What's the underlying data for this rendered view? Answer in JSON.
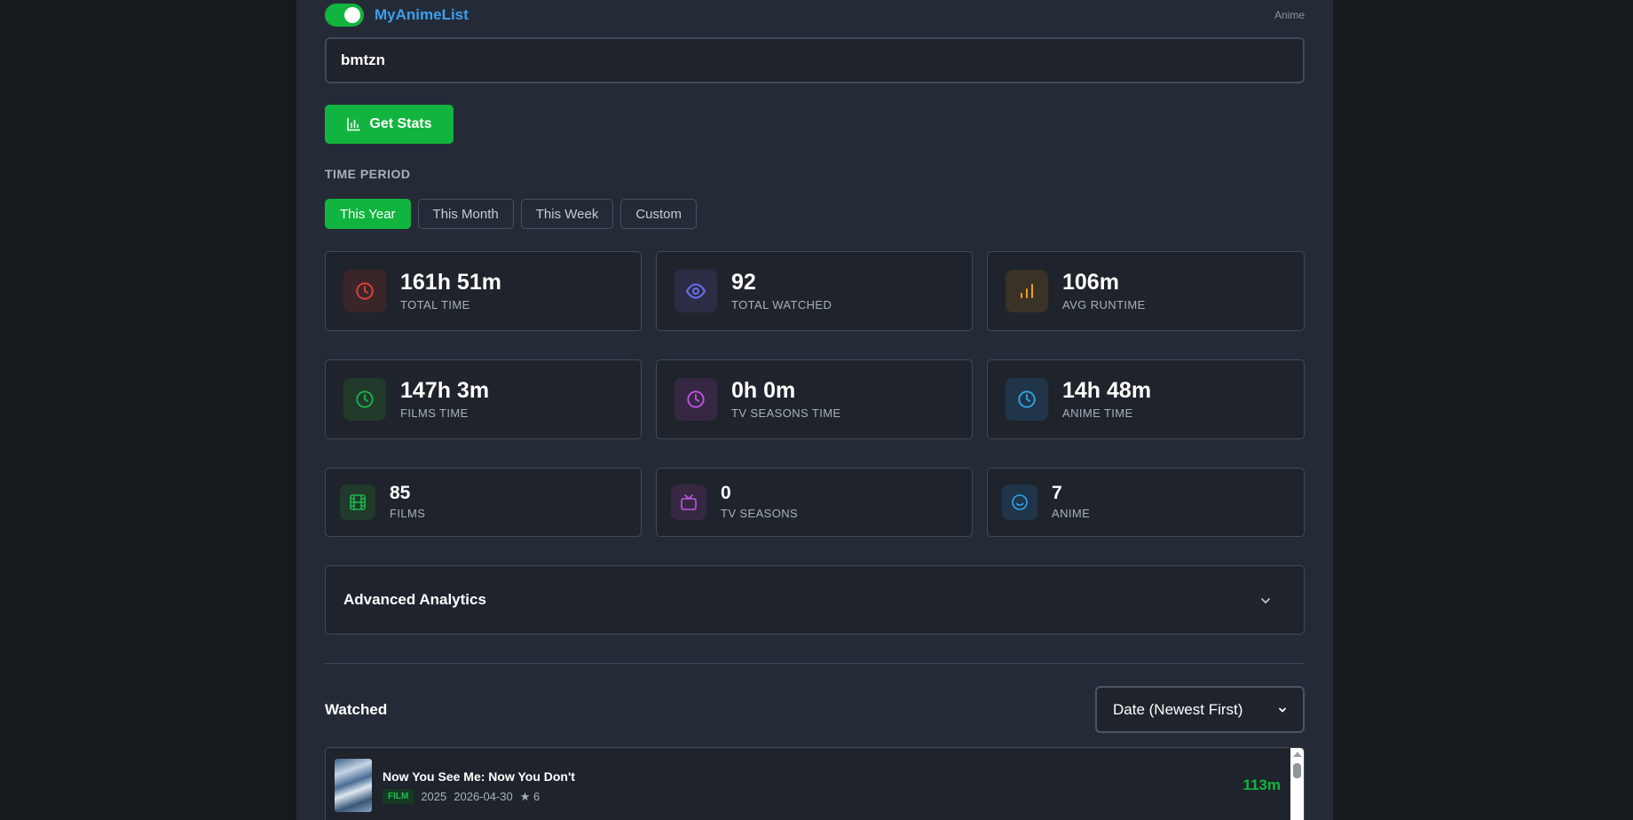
{
  "header": {
    "source_label": "MyAnimeList",
    "media_tag": "Anime",
    "toggle_on": true
  },
  "search": {
    "username_value": "bmtzn"
  },
  "actions": {
    "get_stats_label": "Get Stats"
  },
  "time_period": {
    "label": "TIME PERIOD",
    "options": [
      "This Year",
      "This Month",
      "This Week",
      "Custom"
    ],
    "selected": "This Year"
  },
  "stats": [
    {
      "value": "161h 51m",
      "label": "TOTAL TIME",
      "icon": "clock-icon",
      "color": "#e5413b",
      "bg": "#3a2629"
    },
    {
      "value": "92",
      "label": "TOTAL WATCHED",
      "icon": "eye-icon",
      "color": "#6d6ef2",
      "bg": "#2c2d45"
    },
    {
      "value": "106m",
      "label": "AVG RUNTIME",
      "icon": "bar-chart-icon",
      "color": "#f2a01f",
      "bg": "#3a3226"
    },
    {
      "value": "147h 3m",
      "label": "FILMS TIME",
      "icon": "clock-icon",
      "color": "#18b54a",
      "bg": "#223a2c"
    },
    {
      "value": "0h 0m",
      "label": "TV SEASONS TIME",
      "icon": "clock-icon",
      "color": "#c155e6",
      "bg": "#362842"
    },
    {
      "value": "14h 48m",
      "label": "ANIME TIME",
      "icon": "clock-icon",
      "color": "#2ea6e6",
      "bg": "#21354a"
    }
  ],
  "counts": [
    {
      "value": "85",
      "label": "FILMS",
      "icon": "film-icon",
      "color": "#18b54a",
      "bg": "#223a2c"
    },
    {
      "value": "0",
      "label": "TV SEASONS",
      "icon": "tv-icon",
      "color": "#c155e6",
      "bg": "#362842"
    },
    {
      "value": "7",
      "label": "ANIME",
      "icon": "smile-icon",
      "color": "#2ea6e6",
      "bg": "#21354a"
    }
  ],
  "advanced": {
    "title": "Advanced Analytics"
  },
  "watched": {
    "title": "Watched",
    "sort_selected": "Date (Newest First)",
    "items": [
      {
        "title": "Now You See Me: Now You Don't",
        "type": "FILM",
        "year": "2025",
        "date": "2026-04-30",
        "rating": "★ 6",
        "runtime": "113m"
      }
    ]
  },
  "colors": {
    "accent": "#11b43e",
    "link": "#3b9ff0",
    "panel": "#252b36",
    "card": "#1f242c"
  }
}
